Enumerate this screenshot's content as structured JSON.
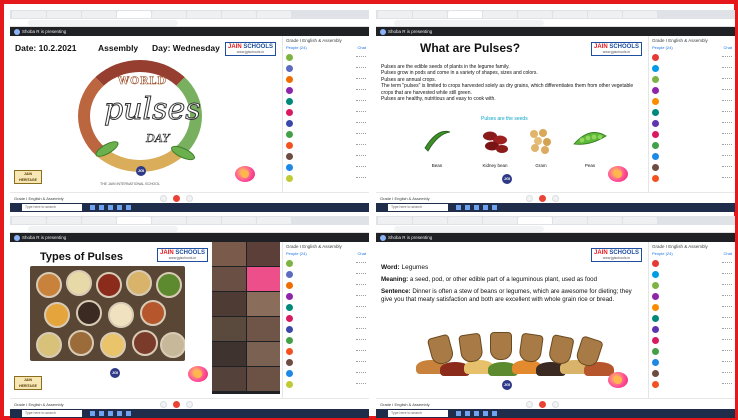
{
  "colors": {
    "frame_border": "#e5181c",
    "meet_end_call": "#ea4335",
    "taskbar": "#1f2c4a",
    "seeds_caption": "#0aa4c4"
  },
  "common": {
    "presenter_banner": "Shoba R is presenting",
    "meeting_name": "Grade I English & Assembly",
    "panel_title": "Grade I English & Assembly",
    "panel_tab_people": "People (24)",
    "panel_tab_chat": "Chat",
    "taskbar_search": "Type here to search",
    "logo_main_a": "JAIN",
    "logo_main_b": "SCHOOLS",
    "logo_url": "www.jgischools.in",
    "jain_badge_line1": "JAIN",
    "jain_badge_line2": "HERITAGE",
    "footer_text": "THE JAIN INTERNATIONAL SCHOOL",
    "footer_logo": "JGI",
    "turn_on_captions": "Turn on captions",
    "present_now": "Present now"
  },
  "slide1": {
    "date_label": "Date: 10.2.2021",
    "assembly_label": "Assembly",
    "day_label": "Day: Wednesday",
    "art_world": "WORLD",
    "art_pulses": "pulses",
    "art_day": "DAY"
  },
  "slide2": {
    "title": "What are Pulses?",
    "body": [
      "Pulses are the edible seeds of plants in the legume family.",
      "Pulses grow in pods and come in a variety of shapes, sizes and colors.",
      "Pulses are annual crops.",
      "The term \"pulses\" is limited to crops harvested solely as dry grains, which differentiates them from other vegetable crops that are harvested while still green.",
      "Pulses are healthy, nutritious and easy to cook with."
    ],
    "seeds_caption": "Pulses are the seeds",
    "labels": [
      "Bean",
      "Kidney bean",
      "Gram",
      "Peas"
    ]
  },
  "slide3": {
    "title": "Types of Pulses"
  },
  "slide4": {
    "word_label": "Word:",
    "word": "Legumes",
    "meaning_label": "Meaning:",
    "meaning": "a seed, pod, or other edible part of a leguminous plant, used as food",
    "sentence_label": "Sentence:",
    "sentence": "Dinner is often a stew of beans or legumes, which are awesome for dieting; they give you that meaty satisfaction and both are excellent with whole grain rice or bread."
  }
}
